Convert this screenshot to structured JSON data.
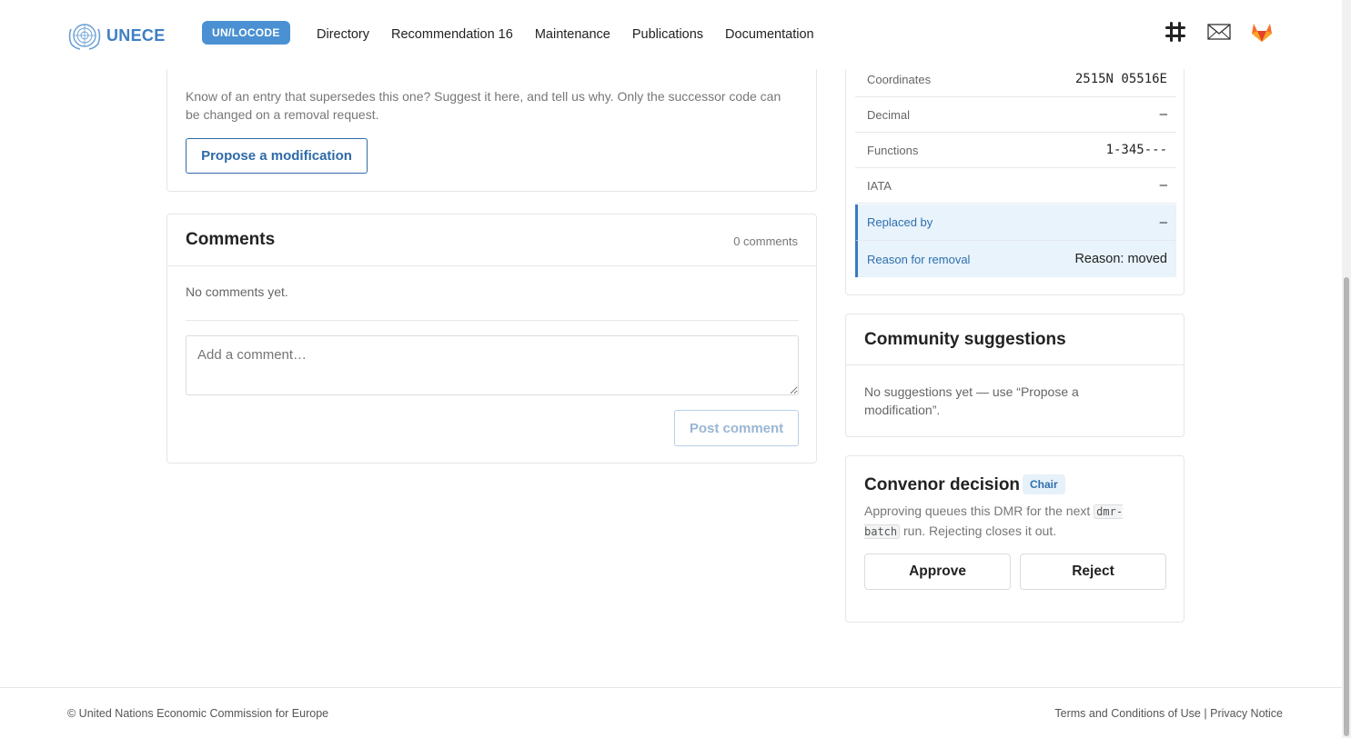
{
  "header": {
    "logo_text": "UNECE",
    "badge": "UN/LOCODE",
    "nav": [
      "Directory",
      "Recommendation 16",
      "Maintenance",
      "Publications",
      "Documentation"
    ],
    "icons": [
      "slack-icon",
      "mail-icon",
      "gitlab-icon"
    ]
  },
  "modification": {
    "text": "Know of an entry that supersedes this one? Suggest it here, and tell us why. Only the successor code can be changed on a removal request.",
    "button": "Propose a modification"
  },
  "comments": {
    "title": "Comments",
    "count": "0 comments",
    "empty": "No comments yet.",
    "placeholder": "Add a comment…",
    "post_button": "Post comment"
  },
  "details": {
    "rows": [
      {
        "label": "Coordinates",
        "value": "2515N 05516E"
      },
      {
        "label": "Decimal",
        "value": "—"
      },
      {
        "label": "Functions",
        "value": "1-345---"
      },
      {
        "label": "IATA",
        "value": "—"
      },
      {
        "label": "Replaced by",
        "value": "—"
      },
      {
        "label": "Reason for removal",
        "value": "Reason: moved"
      }
    ]
  },
  "suggestions": {
    "title": "Community suggestions",
    "empty": "No suggestions yet — use “Propose a modification”."
  },
  "decision": {
    "title": "Convenor decision",
    "badge": "Chair",
    "text_before": "Approving queues this DMR for the next ",
    "code": "dmr-batch",
    "text_after": " run. Rejecting closes it out.",
    "approve": "Approve",
    "reject": "Reject"
  },
  "footer": {
    "copyright": "© United Nations Economic Commission for Europe",
    "terms": "Terms and Conditions of Use",
    "separator": "|",
    "privacy": "Privacy Notice"
  },
  "colors": {
    "accent": "#2e6aa8",
    "badge_bg": "#4a90d2",
    "highlight_bg": "#e8f3fb"
  }
}
